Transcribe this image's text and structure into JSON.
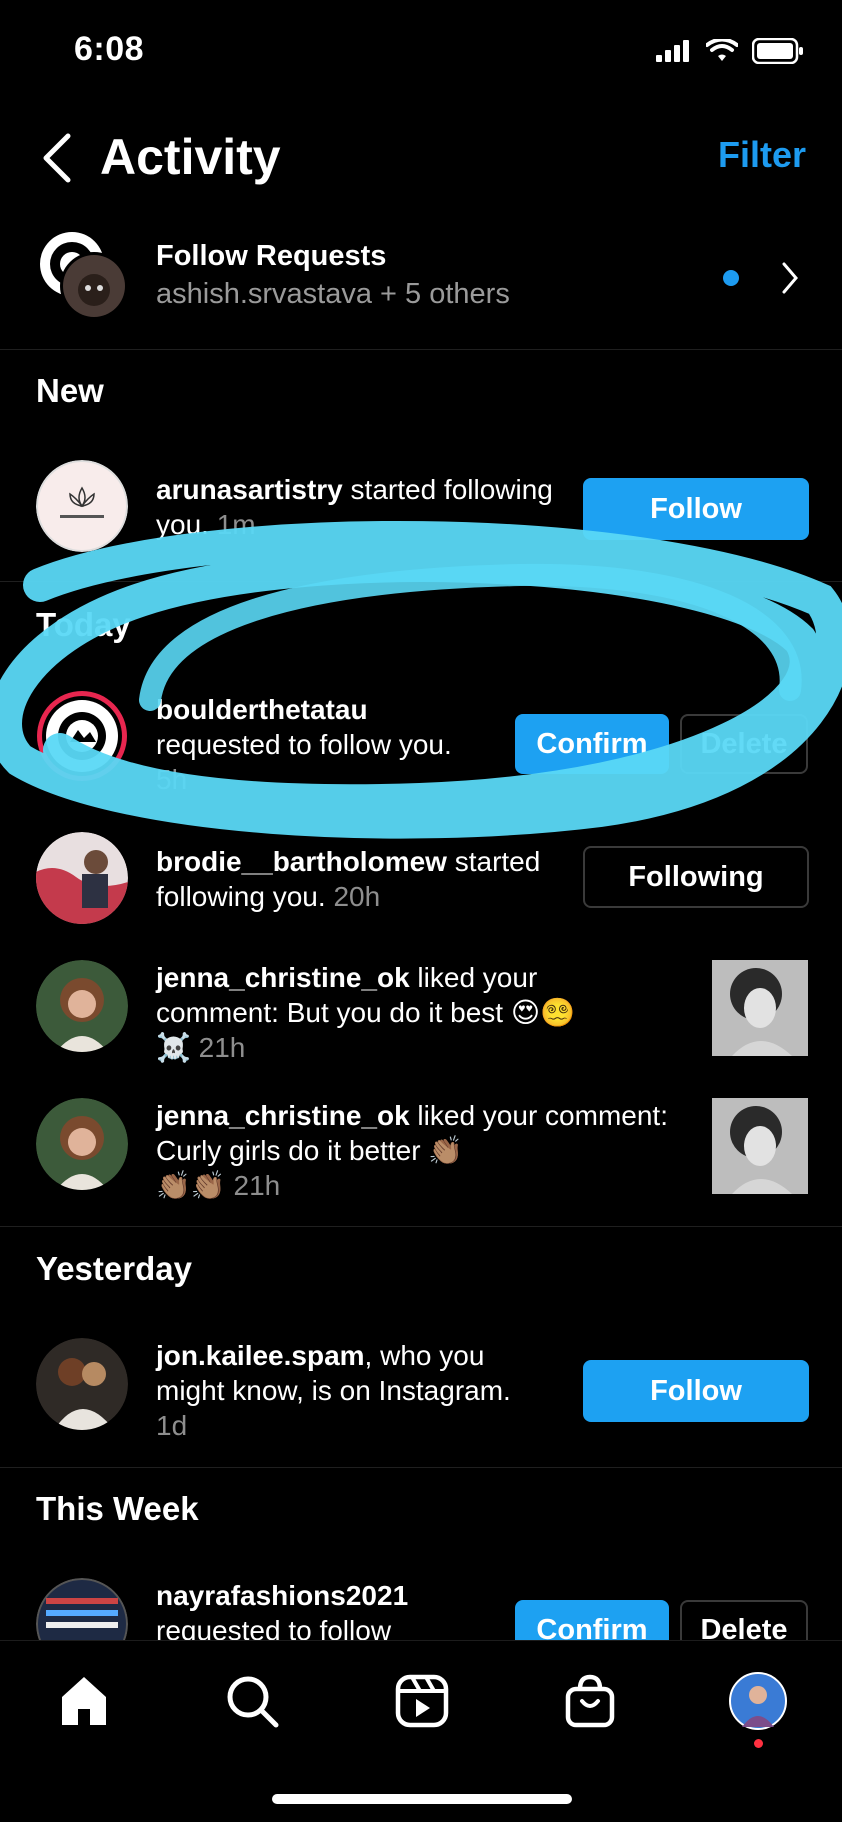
{
  "status": {
    "time": "6:08"
  },
  "header": {
    "title": "Activity",
    "filter_label": "Filter"
  },
  "follow_requests": {
    "title": "Follow Requests",
    "subtitle": "ashish.srvastava + 5 others"
  },
  "sections": {
    "new": "New",
    "today": "Today",
    "yesterday": "Yesterday",
    "this_week": "This Week"
  },
  "rows": [
    {
      "user": "arunasartistry",
      "text": " started following you.",
      "time": "1m",
      "button": "Follow",
      "avatar_text": "ARUNA'S ARTISTRY"
    },
    {
      "user": "boulderthetatau",
      "text": " requested to follow you.",
      "time": "5h",
      "confirm": "Confirm",
      "delete": "Delete",
      "avatar_text": "THETA TAU"
    },
    {
      "user": "brodie__bartholomew",
      "text": " started following you.",
      "time": "20h",
      "button": "Following"
    },
    {
      "user": "jenna_christine_ok",
      "text": " liked your comment: But you do it best 😍😵‍💫",
      "text2": "☠️",
      "time": "21h"
    },
    {
      "user": "jenna_christine_ok",
      "text": " liked your comment: Curly girls do it better 👏🏽",
      "text2": "👏🏽👏🏽",
      "time": "21h"
    },
    {
      "user": "jon.kailee.spam",
      "text": ", who you might know, is on Instagram.",
      "time": "1d",
      "button": "Follow"
    },
    {
      "user": "nayrafashions2021",
      "text": " requested to follow",
      "confirm": "Confirm",
      "delete": "Delete",
      "avatar_text": "NYEFINYFINYFINYF"
    }
  ],
  "colors": {
    "accent": "#1da1f2",
    "highlight": "#5ad8f5",
    "notification": "#ff3040"
  },
  "tabs": [
    "home-icon",
    "search-icon",
    "reels-icon",
    "shop-icon",
    "profile-avatar"
  ]
}
